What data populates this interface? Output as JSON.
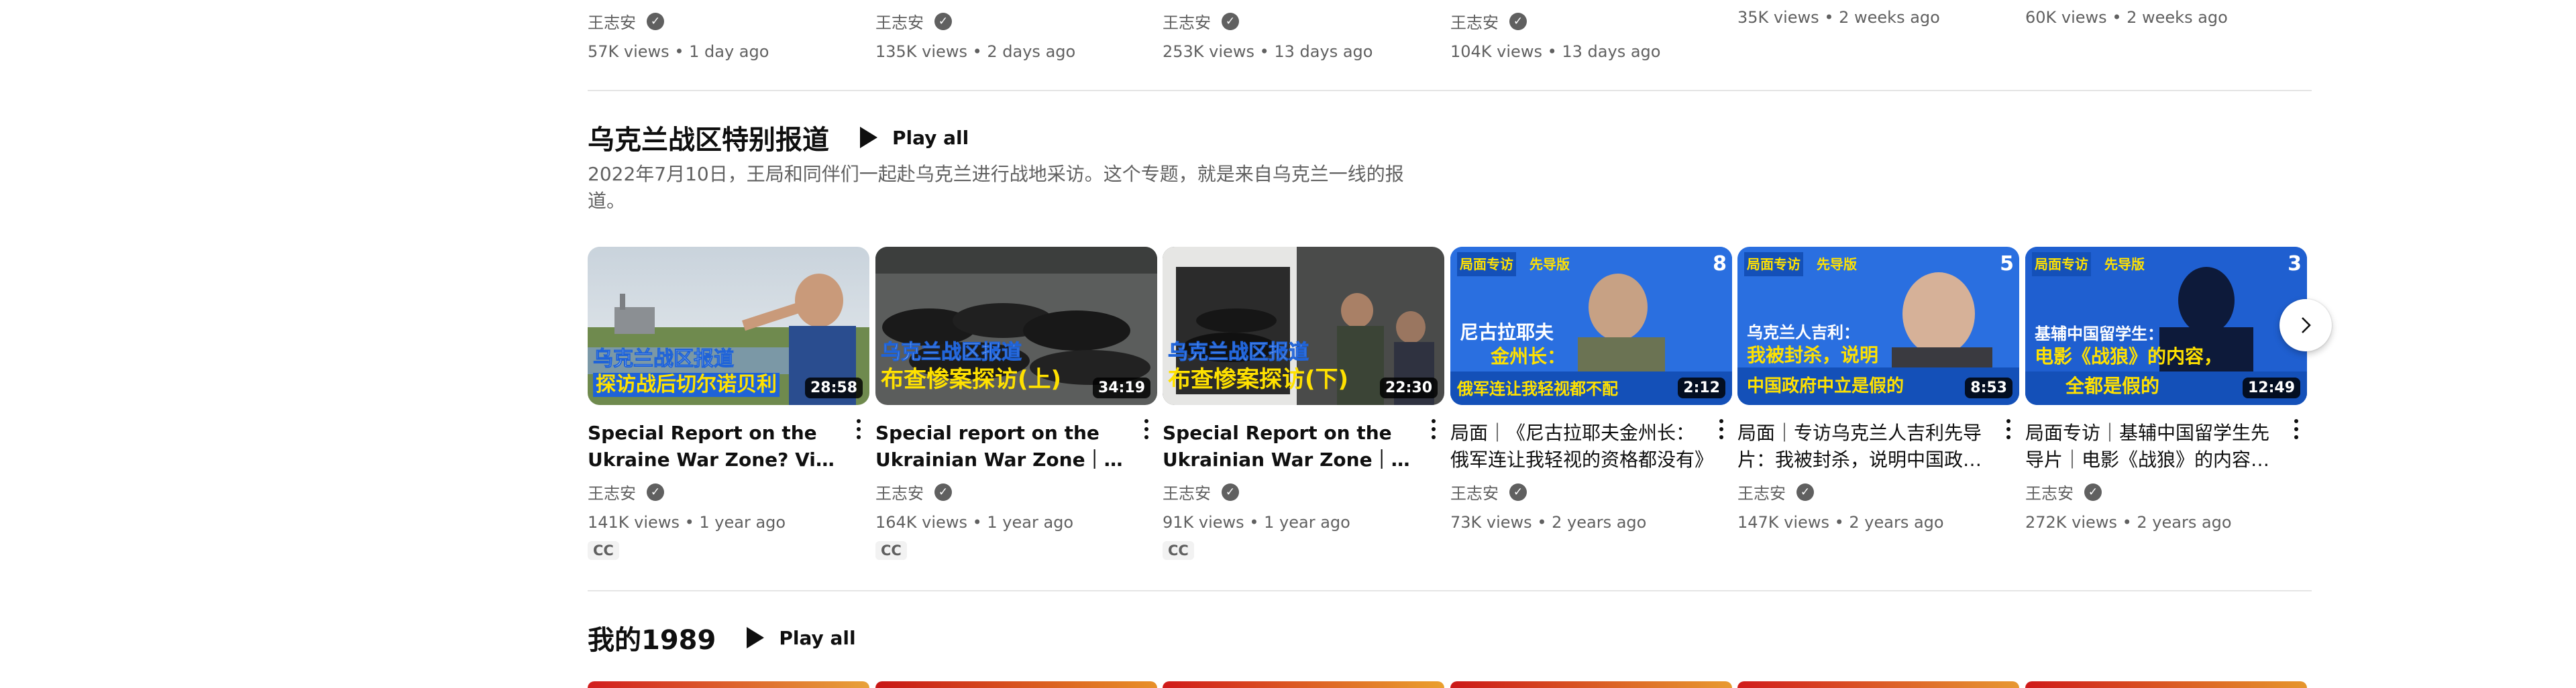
{
  "top_row": [
    {
      "channel": "王志安",
      "views": "57K views",
      "age": "1 day ago"
    },
    {
      "channel": "王志安",
      "views": "135K views",
      "age": "2 days ago"
    },
    {
      "channel": "王志安",
      "views": "253K views",
      "age": "13 days ago"
    },
    {
      "channel": "王志安",
      "views": "104K views",
      "age": "13 days ago"
    },
    {
      "channel": "",
      "views": "35K views",
      "age": "2 weeks ago"
    },
    {
      "channel": "",
      "views": "60K views",
      "age": "2 weeks ago"
    }
  ],
  "separator": "•",
  "shelf": {
    "title": "乌克兰战区特别报道",
    "play_all": "Play all",
    "description": "2022年7月10日，王局和同伴们一起赴乌克兰进行战地采访。这个专题，就是来自乌克兰一线的报道。"
  },
  "videos": [
    {
      "title": "Special Report on the Ukraine War Zone? Visit Post-War Chernobyl",
      "channel": "王志安",
      "views": "141K views",
      "age": "1 year ago",
      "duration": "28:58",
      "badge": "CC",
      "overlay_line1": "乌克兰战区报道",
      "overlay_line2": "探访战后切尔诺贝利"
    },
    {
      "title": "Special report on the Ukrainian War Zone｜Visiting the Bucha Massacre",
      "channel": "王志安",
      "views": "164K views",
      "age": "1 year ago",
      "duration": "34:19",
      "badge": "CC",
      "overlay_line1": "乌克兰战区报道",
      "overlay_line2": "布查惨案探访(上)"
    },
    {
      "title": "Special Report on the Ukrainian War Zone｜Visiting the Bucha Massacre",
      "channel": "王志安",
      "views": "91K views",
      "age": "1 year ago",
      "duration": "22:30",
      "badge": "CC",
      "overlay_line1": "乌克兰战区报道",
      "overlay_line2": "布查惨案探访(下)"
    },
    {
      "title": "局面｜《尼古拉耶夫金州长：俄军连让我轻视的资格都没有》",
      "channel": "王志安",
      "views": "73K views",
      "age": "2 years ago",
      "duration": "2:12",
      "episode": "8",
      "tag1": "局面专访",
      "tag2": "先导版",
      "overlay_line1": "尼古拉耶夫",
      "overlay_line2": "金州长：",
      "overlay_line3": "俄军连让我轻视都不配"
    },
    {
      "title": "局面｜专访乌克兰人吉利先导片：我被封杀，说明中国政府中立是假的",
      "channel": "王志安",
      "views": "147K views",
      "age": "2 years ago",
      "duration": "8:53",
      "episode": "5",
      "tag1": "局面专访",
      "tag2": "先导版",
      "overlay_line1": "乌克兰人吉利：",
      "overlay_line2": "我被封杀，说明",
      "overlay_line3": "中国政府中立是假的"
    },
    {
      "title": "局面专访｜基辅中国留学生先导片｜电影《战狼》的内容都是假的",
      "channel": "王志安",
      "views": "272K views",
      "age": "2 years ago",
      "duration": "12:49",
      "episode": "3",
      "tag1": "局面专访",
      "tag2": "先导版",
      "overlay_line1": "基辅中国留学生：",
      "overlay_line2": "电影《战狼》的内容，",
      "overlay_line3": "全都是假的"
    }
  ],
  "next_shelf": {
    "title": "我的1989",
    "play_all": "Play all"
  },
  "colors": {
    "text_primary": "#0f0f0f",
    "text_secondary": "#606060",
    "overlay_yellow": "#ffe100",
    "overlay_blue_bg": "#1f63d8",
    "divider": "#e5e5e5"
  }
}
